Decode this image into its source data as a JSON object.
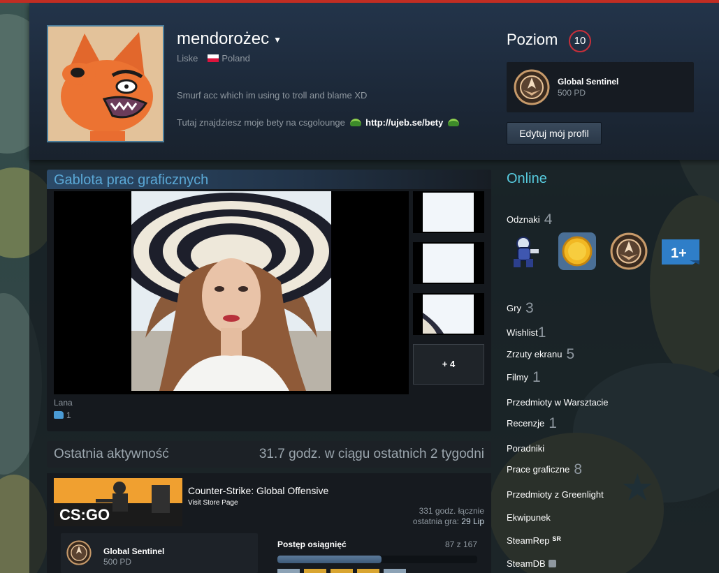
{
  "profile": {
    "persona_name": "mendorożec",
    "real_name": "Liske",
    "country": "Poland",
    "summary_line1": "Smurf acc which im using to troll and blame XD",
    "summary_line2": "Tutaj znajdziesz moje bety na csgolounge",
    "summary_link": "http://ujeb.se/bety"
  },
  "level": {
    "label": "Poziom",
    "value": "10",
    "favorite_badge": {
      "name": "Global Sentinel",
      "xp": "500 PD"
    },
    "edit_button": "Edytuj mój profil"
  },
  "showcase": {
    "title": "Gablota prac graficznych",
    "main_caption": "Lana",
    "rating_count": "1",
    "more_label": "+ 4"
  },
  "activity": {
    "title": "Ostatnia aktywność",
    "hours_summary": "31.7 godz. w ciągu ostatnich 2 tygodni",
    "game": {
      "name": "Counter-Strike: Global Offensive",
      "store_link": "Visit Store Page",
      "total_hours_value": "331 godz.",
      "total_hours_label": "łącznie",
      "last_played_label": "ostatnia gra:",
      "last_played_value": "29 Lip",
      "capsule_text": "CS:GO",
      "badge_name": "Global Sentinel",
      "badge_xp": "500 PD",
      "achievements_label": "Postęp osiągnięć",
      "achievements_count": "87 z 167",
      "achievements_fraction": 0.52
    }
  },
  "sidebar": {
    "status": "Online",
    "badges_label": "Odznaki",
    "badges_count": "4",
    "links": [
      {
        "label": "Gry",
        "count": "3"
      },
      {
        "label": "Wishlist",
        "count": "1"
      },
      {
        "label": "Zrzuty ekranu",
        "count": "5"
      },
      {
        "label": "Filmy",
        "count": "1"
      },
      {
        "label": "Przedmioty w Warsztacie",
        "count": ""
      },
      {
        "label": "Recenzje",
        "count": "1"
      },
      {
        "label": "Poradniki",
        "count": ""
      },
      {
        "label": "Prace graficzne",
        "count": "8"
      },
      {
        "label": "Przedmioty z Greenlight",
        "count": ""
      },
      {
        "label": "Ekwipunek",
        "count": ""
      },
      {
        "label": "SteamRep",
        "count": ""
      },
      {
        "label": "SteamDB",
        "count": ""
      }
    ],
    "badge_icons": [
      "astronaut-badge-icon",
      "gold-coin-badge-icon",
      "global-sentinel-badge-icon",
      "years-of-service-badge-icon"
    ],
    "steamrep_mark": "SR",
    "years_badge_text": "1+"
  },
  "colors": {
    "accent_red": "#c12d23",
    "online_blue": "#57cbde",
    "showcase_title": "#5aa8d6",
    "level_ring": "#c92f3a"
  }
}
